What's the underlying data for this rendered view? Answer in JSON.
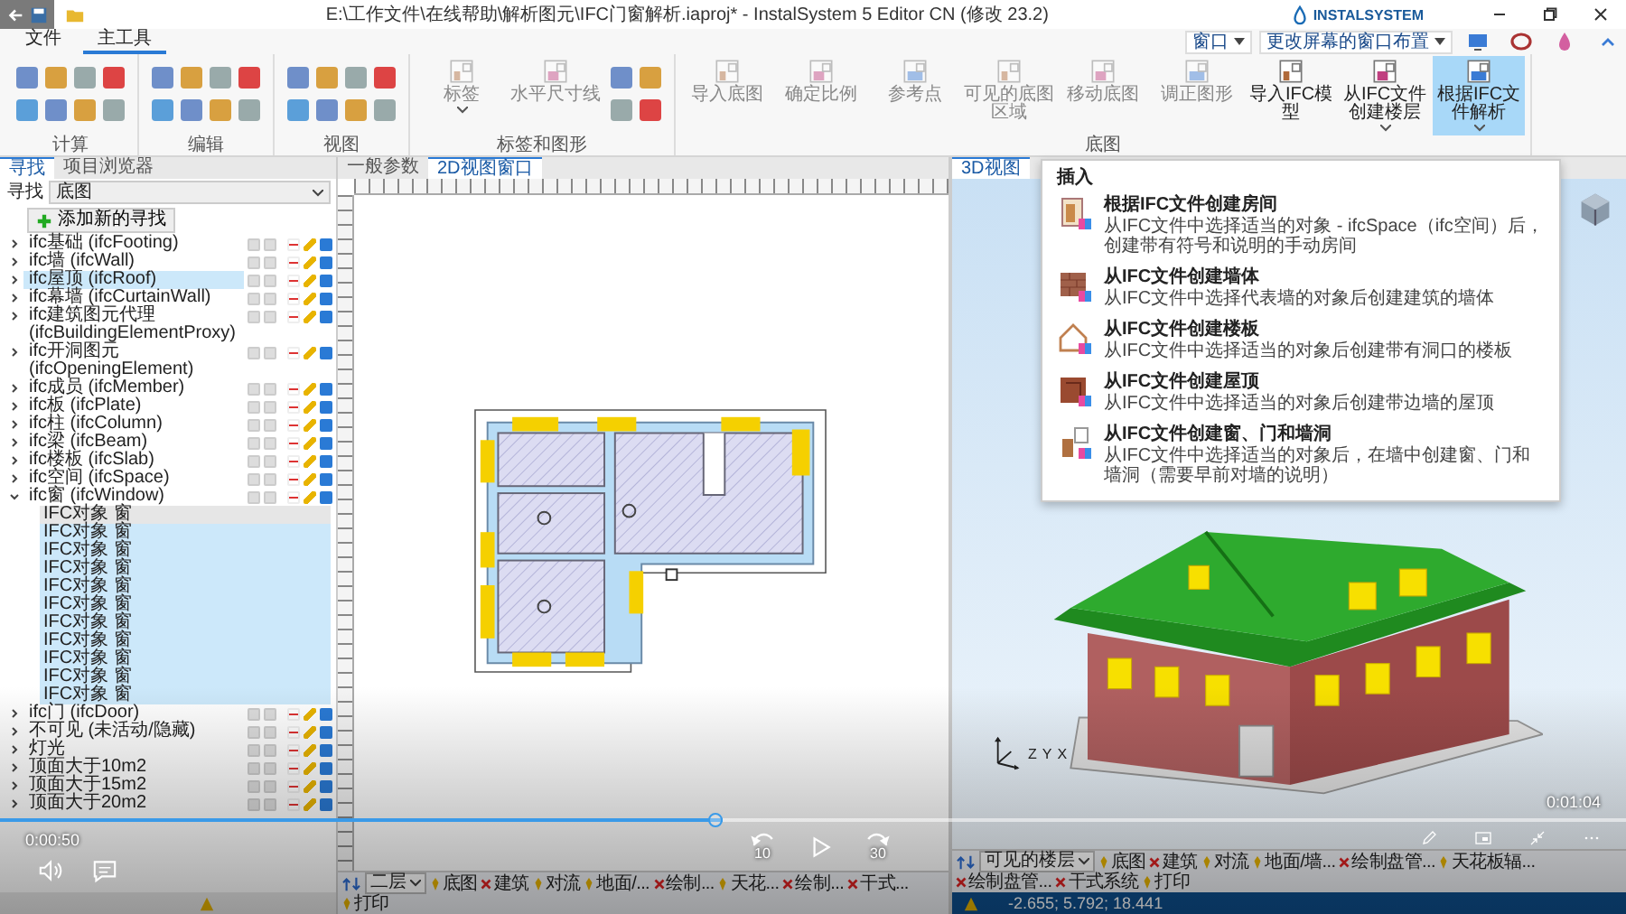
{
  "title_bar": {
    "title": "E:\\工作文件\\在线帮助\\解析图元\\IFC门窗解析.iaproj* - InstalSystem 5 Editor CN (修改 23.2)",
    "brand": "INSTALSYSTEM"
  },
  "menu_bar": {
    "tabs": [
      {
        "label": "文件",
        "selected": false
      },
      {
        "label": "主工具",
        "selected": true
      }
    ],
    "window_menu": "窗口",
    "layout_menu": "更改屏幕的窗口布置"
  },
  "ribbon": {
    "groups": [
      {
        "label": "计算",
        "kind": "tools"
      },
      {
        "label": "编辑",
        "kind": "tools"
      },
      {
        "label": "视图",
        "kind": "tools"
      },
      {
        "label": "标签和图形",
        "kind": "mixed",
        "buttons": [
          {
            "label": "标签",
            "disabled": true,
            "selected": false,
            "has_menu": true
          },
          {
            "label": "水平尺寸线",
            "disabled": true,
            "selected": false,
            "has_menu": false
          }
        ]
      },
      {
        "label": "底图",
        "kind": "buttons",
        "buttons": [
          {
            "label": "导入底图",
            "disabled": true,
            "selected": false,
            "has_menu": false
          },
          {
            "label": "确定比例",
            "disabled": true,
            "selected": false,
            "has_menu": false
          },
          {
            "label": "参考点",
            "disabled": true,
            "selected": false,
            "has_menu": false
          },
          {
            "label": "可见的底图区域",
            "disabled": true,
            "selected": false,
            "has_menu": false
          },
          {
            "label": "移动底图",
            "disabled": true,
            "selected": false,
            "has_menu": false
          },
          {
            "label": "调正图形",
            "disabled": true,
            "selected": false,
            "has_menu": false
          },
          {
            "label": "导入IFC模型",
            "disabled": false,
            "selected": false,
            "has_menu": false
          },
          {
            "label": "从IFC文件创建楼层",
            "disabled": false,
            "selected": false,
            "has_menu": true
          },
          {
            "label": "根据IFC文件解析",
            "disabled": false,
            "selected": true,
            "has_menu": true
          }
        ]
      }
    ]
  },
  "search_panel": {
    "tabs": [
      {
        "label": "寻找",
        "selected": true
      },
      {
        "label": "项目浏览器",
        "selected": false
      }
    ],
    "field_label": "寻找",
    "dropdown_value": "底图",
    "add_button": "添加新的寻找",
    "items": [
      {
        "label": "ifc基础 (ifcFooting)",
        "expanded": false,
        "selected": false
      },
      {
        "label": "ifc墙 (ifcWall)",
        "expanded": false,
        "selected": false
      },
      {
        "label": "ifc屋顶 (ifcRoof)",
        "expanded": false,
        "selected": true
      },
      {
        "label": "ifc幕墙 (ifcCurtainWall)",
        "expanded": false,
        "selected": false
      },
      {
        "label": "ifc建筑图元代理 (ifcBuildingElementProxy)",
        "expanded": false,
        "selected": false
      },
      {
        "label": "ifc开洞图元 (ifcOpeningElement)",
        "expanded": false,
        "selected": false
      },
      {
        "label": "ifc成员 (ifcMember)",
        "expanded": false,
        "selected": false
      },
      {
        "label": "ifc板 (ifcPlate)",
        "expanded": false,
        "selected": false
      },
      {
        "label": "ifc柱 (ifcColumn)",
        "expanded": false,
        "selected": false
      },
      {
        "label": "ifc梁 (ifcBeam)",
        "expanded": false,
        "selected": false
      },
      {
        "label": "ifc楼板 (ifcSlab)",
        "expanded": false,
        "selected": false
      },
      {
        "label": "ifc空间 (ifcSpace)",
        "expanded": false,
        "selected": false
      },
      {
        "label": "ifc窗 (ifcWindow)",
        "expanded": true,
        "selected": false,
        "children": [
          {
            "label": "IFC对象 窗",
            "selected": false
          },
          {
            "label": "IFC对象 窗",
            "selected": true
          },
          {
            "label": "IFC对象 窗",
            "selected": true
          },
          {
            "label": "IFC对象 窗",
            "selected": true
          },
          {
            "label": "IFC对象 窗",
            "selected": true
          },
          {
            "label": "IFC对象 窗",
            "selected": true
          },
          {
            "label": "IFC对象 窗",
            "selected": true
          },
          {
            "label": "IFC对象 窗",
            "selected": true
          },
          {
            "label": "IFC对象 窗",
            "selected": true
          },
          {
            "label": "IFC对象 窗",
            "selected": true
          },
          {
            "label": "IFC对象 窗",
            "selected": true
          }
        ]
      },
      {
        "label": "ifc门 (ifcDoor)",
        "expanded": false,
        "selected": false
      },
      {
        "label": "不可见 (未活动/隐藏)",
        "expanded": false,
        "selected": false
      },
      {
        "label": "灯光",
        "expanded": false,
        "selected": false
      },
      {
        "label": "顶面大于10m2",
        "expanded": false,
        "selected": false
      },
      {
        "label": "顶面大于15m2",
        "expanded": false,
        "selected": false
      },
      {
        "label": "顶面大于20m2",
        "expanded": false,
        "selected": false
      }
    ]
  },
  "plan_panel": {
    "tabs": [
      {
        "label": "一般参数",
        "selected": false
      },
      {
        "label": "2D视图窗口",
        "selected": true
      }
    ],
    "toolbar": {
      "floor": "二层",
      "items": [
        {
          "label": "底图",
          "kind": "pin"
        },
        {
          "label": "建筑",
          "kind": "cross"
        },
        {
          "label": "对流",
          "kind": "pin"
        },
        {
          "label": "地面/...",
          "kind": "pin"
        },
        {
          "label": "绘制...",
          "kind": "cross"
        },
        {
          "label": "天花...",
          "kind": "pin"
        },
        {
          "label": "绘制...",
          "kind": "cross"
        },
        {
          "label": "干式...",
          "kind": "cross"
        },
        {
          "label": "打印",
          "kind": "pin"
        }
      ]
    }
  },
  "view3d_panel": {
    "tabs": [
      {
        "label": "3D视图",
        "selected": true
      }
    ],
    "axis_labels": [
      "Z",
      "Y",
      "X"
    ],
    "toolbar": {
      "floor": "可见的楼层",
      "items": [
        {
          "label": "底图",
          "kind": "pin"
        },
        {
          "label": "建筑",
          "kind": "cross"
        },
        {
          "label": "对流",
          "kind": "pin"
        },
        {
          "label": "地面/墙...",
          "kind": "pin"
        },
        {
          "label": "绘制盘管...",
          "kind": "cross"
        },
        {
          "label": "天花板辐...",
          "kind": "pin"
        },
        {
          "label": "绘制盘管...",
          "kind": "cross"
        },
        {
          "label": "干式系统",
          "kind": "cross"
        },
        {
          "label": "打印",
          "kind": "pin"
        }
      ]
    },
    "status": {
      "coordinates": "-2.655; 5.792; 18.441"
    }
  },
  "ifc_menu": {
    "header": "插入",
    "items": [
      {
        "kind": "room",
        "title": "根据IFC文件创建房间",
        "description": "从IFC文件中选择适当的对象 - ifcSpace（ifc空间）后，创建带有符号和说明的手动房间"
      },
      {
        "kind": "wall",
        "title": "从IFC文件创建墙体",
        "description": "从IFC文件中选择代表墙的对象后创建建筑的墙体"
      },
      {
        "kind": "slab",
        "title": "从IFC文件创建楼板",
        "description": "从IFC文件中选择适当的对象后创建带有洞口的楼板"
      },
      {
        "kind": "roof",
        "title": "从IFC文件创建屋顶",
        "description": "从IFC文件中选择适当的对象后创建带边墙的屋顶"
      },
      {
        "kind": "opening",
        "title": "从IFC文件创建窗、门和墙洞",
        "description": "从IFC文件中选择适当的对象后，在墙中创建窗、门和墙洞（需要早前对墙的说明）"
      }
    ]
  },
  "video_player": {
    "elapsed": "0:00:50",
    "duration": "0:01:04",
    "level": 0.444,
    "rewind_label": "10",
    "forward_label": "30"
  }
}
